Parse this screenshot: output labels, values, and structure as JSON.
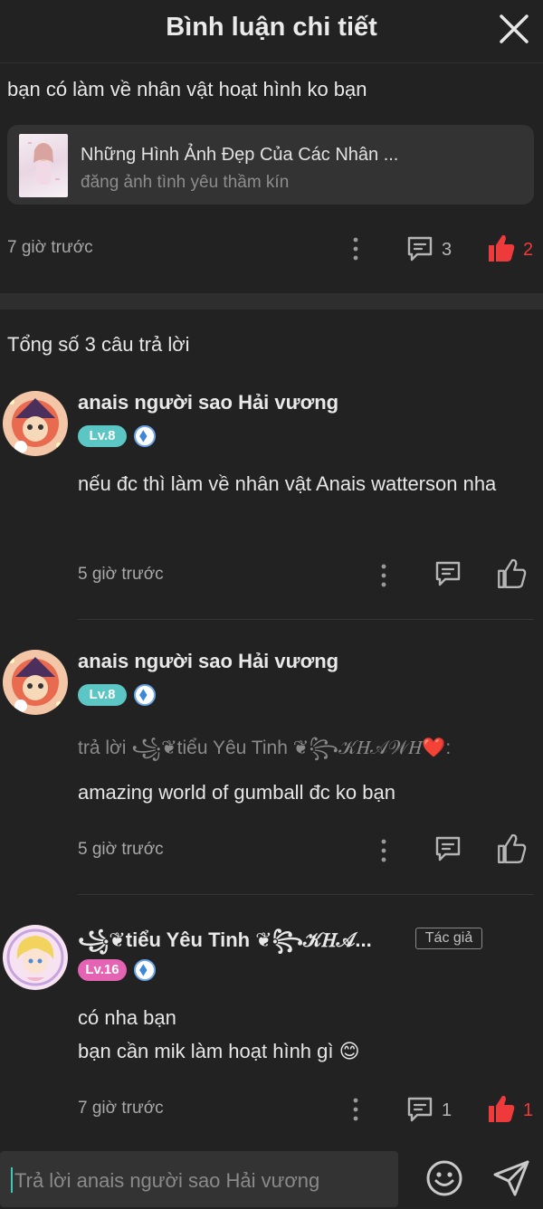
{
  "header": {
    "title": "Bình luận chi tiết"
  },
  "main_comment": {
    "text": "bạn có làm về nhân vật hoạt hình ko bạn",
    "post": {
      "title": "Những Hình Ảnh Đẹp Của Các Nhân ...",
      "subtitle": "đăng ảnh tình yêu thầm kín"
    },
    "time": "7 giờ trước",
    "comment_count": "3",
    "like_count": "2"
  },
  "total_replies": "Tổng số 3 câu trả lời",
  "replies": [
    {
      "name": "anais người sao Hải vương",
      "level": "Lv.8",
      "level_color": "#5cc6c4",
      "reply_to": "",
      "text": "nếu đc thì làm về nhân vật Anais watterson nha",
      "time": "5 giờ trước"
    },
    {
      "name": "anais người sao Hải vương",
      "level": "Lv.8",
      "level_color": "#5cc6c4",
      "reply_to": "trả lời ꧁❦tiểu Yêu Tinh ❦꧂𝒦𝐻𝒜𝒲𝐻❤️:",
      "text": "amazing world of gumball đc ko bạn",
      "time": "5 giờ trước"
    },
    {
      "name": "꧁❦tiểu Yêu Tinh ❦꧂𝒦𝐻𝒜...",
      "level": "Lv.16",
      "level_color": "#e563b3",
      "author_tag": "Tác giả",
      "line1": "có nha bạn",
      "line2": "bạn cần mik làm hoạt hình gì 😊",
      "time": "7 giờ trước",
      "comment_count": "1",
      "like_count": "1"
    }
  ],
  "input": {
    "placeholder": "Trả lời anais người sao Hải vương"
  },
  "colors": {
    "accent_red": "#ee3a3a",
    "teal": "#3cc7b6"
  }
}
